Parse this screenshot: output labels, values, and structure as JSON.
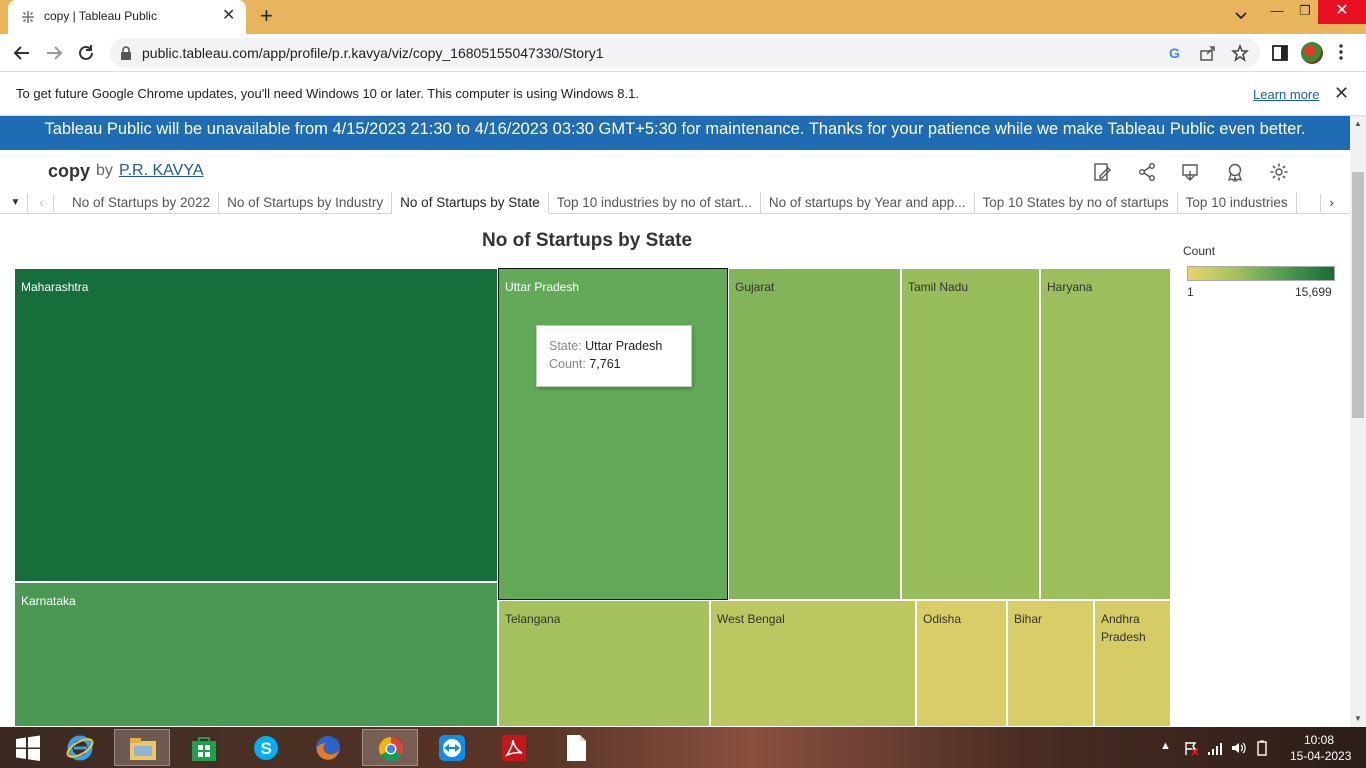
{
  "browser": {
    "tab_title": "copy | Tableau Public",
    "url": "public.tableau.com/app/profile/p.r.kavya/viz/copy_16805155047330/Story1",
    "infobar_text": "To get future Google Chrome updates, you'll need Windows 10 or later. This computer is using Windows 8.1.",
    "infobar_link": "Learn more"
  },
  "page": {
    "banner": "Tableau Public will be unavailable from 4/15/2023 21:30 to 4/16/2023 03:30 GMT+5:30 for maintenance. Thanks for your patience while we make Tableau Public even better.",
    "viz_name": "copy",
    "by_text": "by",
    "author": "P.R. KAVYA"
  },
  "story": {
    "tabs": [
      "No of Startups by 2022",
      "No of Startups by Industry",
      "No of Startups by State",
      "Top 10 industries by no of start...",
      "No of startups by Year and app...",
      "Top 10 States by no of startups",
      "Top 10 industries"
    ],
    "active_index": 2
  },
  "sheet": {
    "title": "No of Startups by State",
    "legend_title": "Count",
    "legend_min": "1",
    "legend_max": "15,699",
    "tooltip": {
      "state_key": "State:",
      "state_val": "Uttar Pradesh",
      "count_key": "Count:",
      "count_val": "7,761"
    }
  },
  "chart_data": {
    "type": "treemap",
    "title": "No of Startups by State",
    "color_legend": {
      "title": "Count",
      "min": 1,
      "max": 15699,
      "colors": [
        "#e8d56a",
        "#1a6a38"
      ]
    },
    "states": [
      {
        "name": "Maharashtra",
        "color": "#166f3a"
      },
      {
        "name": "Karnataka",
        "color": "#4a9953"
      },
      {
        "name": "Uttar Pradesh",
        "count": 7761,
        "color": "#63aa58"
      },
      {
        "name": "Gujarat",
        "color": "#84b459"
      },
      {
        "name": "Tamil Nadu",
        "color": "#98bd5b"
      },
      {
        "name": "Haryana",
        "color": "#9bbf5c"
      },
      {
        "name": "Telangana",
        "color": "#a6c25e"
      },
      {
        "name": "West Bengal",
        "color": "#bdc762"
      },
      {
        "name": "Odisha",
        "color": "#d8cd66"
      },
      {
        "name": "Bihar",
        "color": "#d8cd66"
      },
      {
        "name": "Andhra Pradesh",
        "color": "#d6cc66"
      }
    ]
  },
  "taskbar": {
    "time": "10:08",
    "date": "15-04-2023"
  }
}
